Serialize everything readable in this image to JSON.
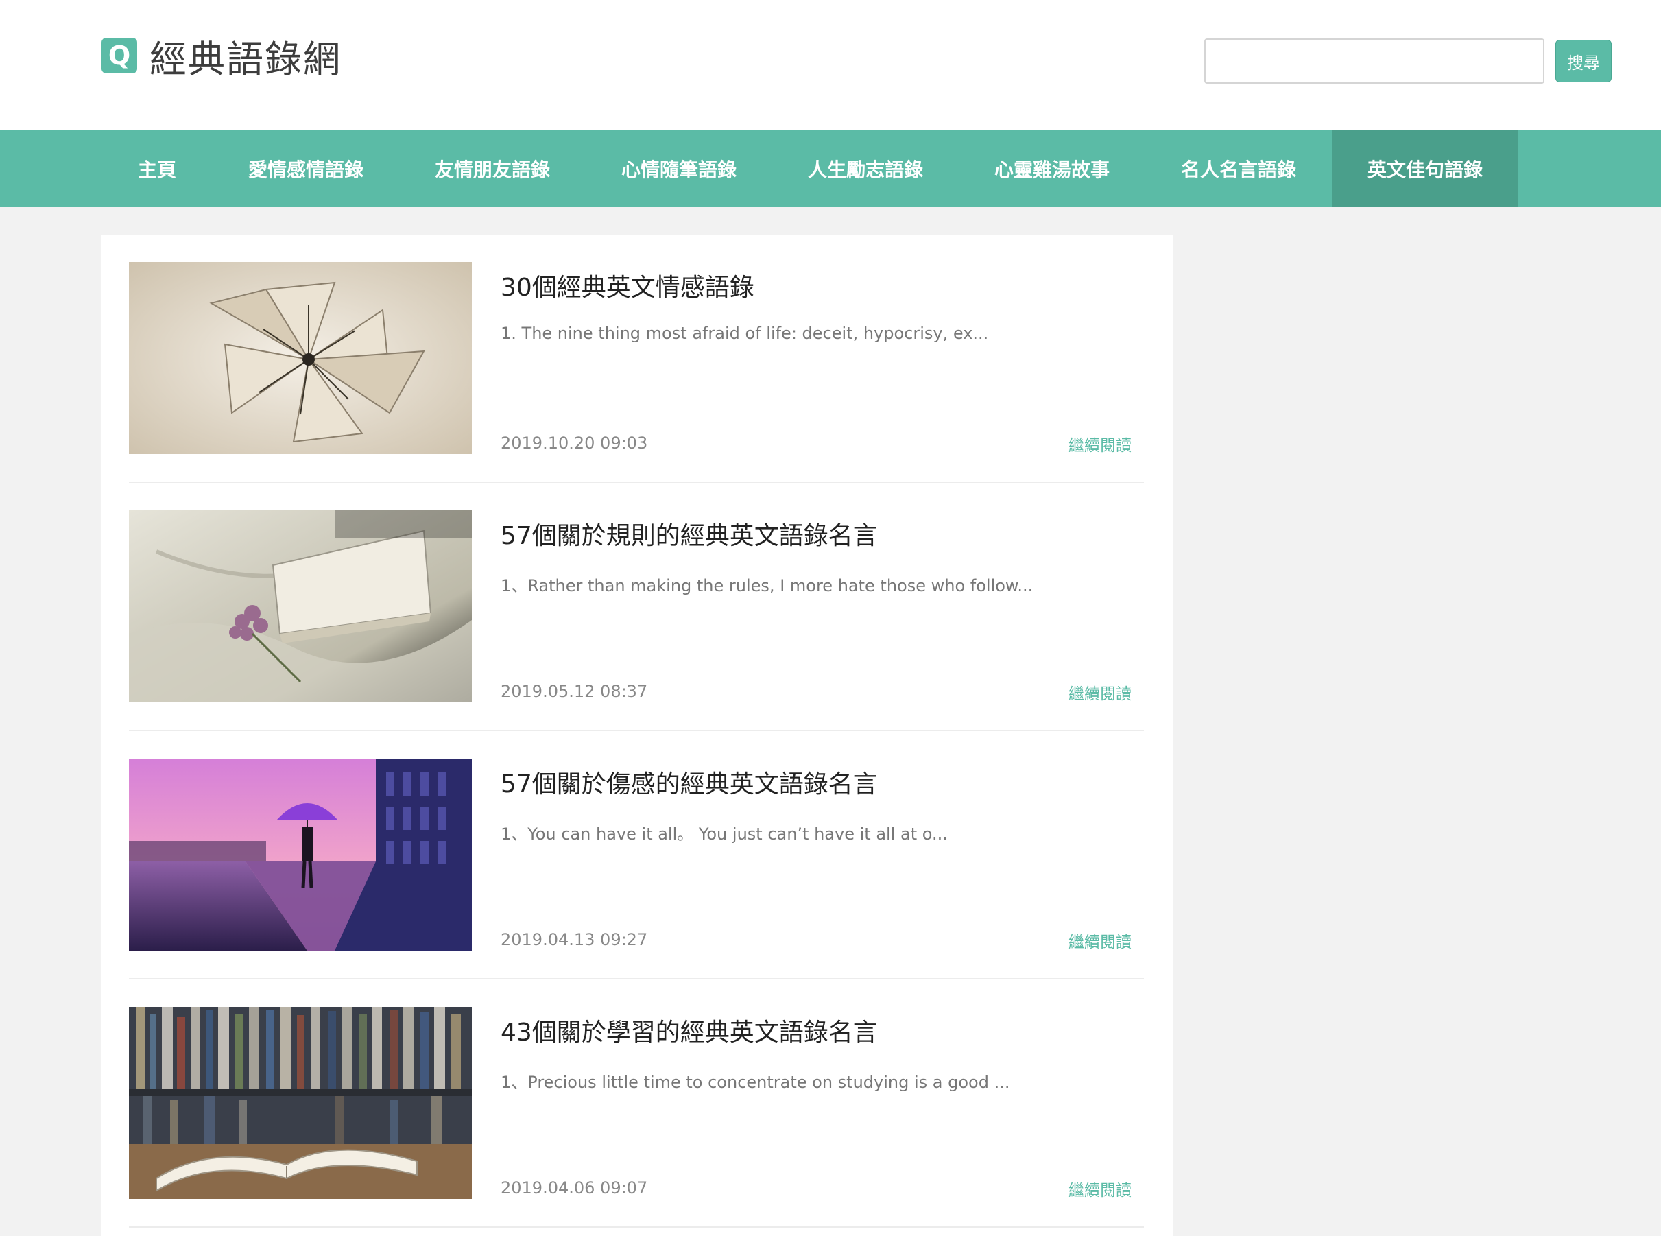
{
  "site": {
    "logo_letter": "Q",
    "name": "經典語錄網"
  },
  "search": {
    "placeholder": "",
    "button_label": "搜尋"
  },
  "nav": {
    "items": [
      {
        "label": "主頁",
        "active": false
      },
      {
        "label": "愛情感情語錄",
        "active": false
      },
      {
        "label": "友情朋友語錄",
        "active": false
      },
      {
        "label": "心情隨筆語錄",
        "active": false
      },
      {
        "label": "人生勵志語錄",
        "active": false
      },
      {
        "label": "心靈雞湯故事",
        "active": false
      },
      {
        "label": "名人名言語錄",
        "active": false
      },
      {
        "label": "英文佳句語錄",
        "active": true
      }
    ]
  },
  "posts": [
    {
      "thumb": "paper-flower-photo",
      "title": "30個經典英文情感語錄",
      "excerpt": "1. The nine thing most afraid of life: deceit, hypocrisy, ex...",
      "date": "2019.10.20 09:03",
      "read_more": "繼續閱讀"
    },
    {
      "thumb": "book-and-flower-photo",
      "title": "57個關於規則的經典英文語錄名言",
      "excerpt": "1、Rather than making the rules, I more hate those who follow...",
      "date": "2019.05.12 08:37",
      "read_more": "繼續閱讀"
    },
    {
      "thumb": "purple-umbrella-photo",
      "title": "57個關於傷感的經典英文語錄名言",
      "excerpt": "1、You can have it all。 You just can’t have it all at o...",
      "date": "2019.04.13 09:27",
      "read_more": "繼續閱讀"
    },
    {
      "thumb": "open-book-library-photo",
      "title": "43個關於學習的經典英文語錄名言",
      "excerpt": "1、Precious little time to concentrate on studying is a good ...",
      "date": "2019.04.06 09:07",
      "read_more": "繼續閱讀"
    }
  ],
  "colors": {
    "accent": "#5bbba6",
    "nav_active": "#4a9f8b",
    "page_bg": "#f2f2f2"
  }
}
